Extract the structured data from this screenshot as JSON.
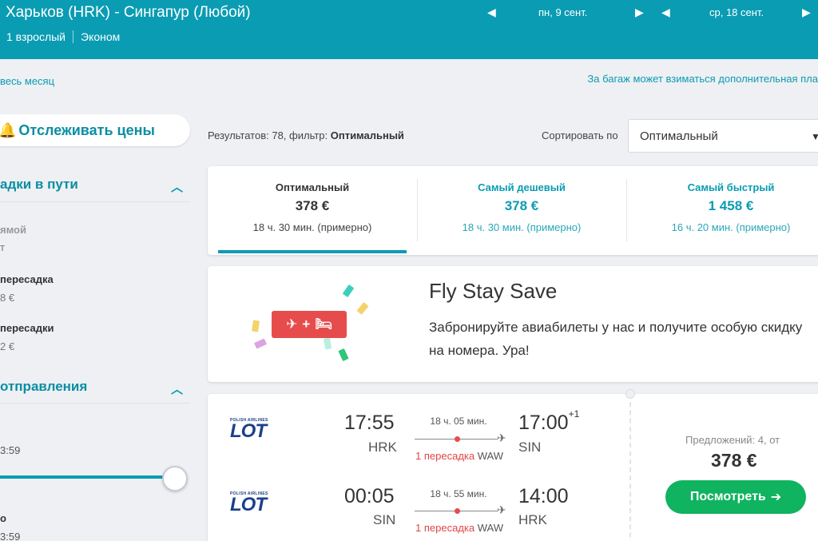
{
  "header": {
    "route": "Харьков (HRK) - Сингапур (Любой)",
    "passengers": "1 взрослый",
    "cabin": "Эконом",
    "depart_date": "пн, 9 сент.",
    "return_date": "ср, 18 сент."
  },
  "links": {
    "whole_month": "весь месяц",
    "baggage": "За багаж может взиматься дополнительная пла"
  },
  "sidebar": {
    "track_label": "Отслеживать цены",
    "stops_title": "адки в пути",
    "stops": [
      {
        "label": "ямой",
        "price": "т"
      },
      {
        "label": "пересадка",
        "price": "8 €"
      },
      {
        "label": "пересадки",
        "price": "2 €"
      }
    ],
    "departure_title": "отправления",
    "time1": "3:59",
    "time2": "3:59",
    "knob_label": "о",
    "slider_level_percent": 100
  },
  "results": {
    "count_text": "Результатов: 78, фильтр: ",
    "filter": "Оптимальный",
    "sort_label": "Сортировать по",
    "sort_value": "Оптимальный"
  },
  "tabs": [
    {
      "title": "Оптимальный",
      "price": "378 €",
      "duration": "18 ч. 30 мин. (примерно)"
    },
    {
      "title": "Самый дешевый",
      "price": "378 €",
      "duration": "18 ч. 30 мин. (примерно)"
    },
    {
      "title": "Самый быстрый",
      "price": "1 458 €",
      "duration": "16 ч. 20 мин. (примерно)"
    }
  ],
  "promo": {
    "title": "Fly Stay Save",
    "text": "Забронируйте авиабилеты у нас и получите особую скидку на номера. Ура!",
    "badge_plus": "+"
  },
  "flight": {
    "airline_small": "POLISH AIRLINES",
    "airline_logo": "LOT",
    "legs": [
      {
        "dep_time": "17:55",
        "dep_code": "HRK",
        "duration": "18 ч. 05 мин.",
        "arr_time": "17:00",
        "arr_sup": "+1",
        "arr_code": "SIN",
        "stops": "1 пересадка",
        "via": "WAW"
      },
      {
        "dep_time": "00:05",
        "dep_code": "SIN",
        "duration": "18 ч. 55 мин.",
        "arr_time": "14:00",
        "arr_sup": "",
        "arr_code": "HRK",
        "stops": "1 пересадка",
        "via": "WAW"
      }
    ],
    "offers": "Предложений: 4, от",
    "price": "378 €",
    "view_label": "Посмотреть"
  },
  "colors": {
    "brand": "#0a9cb3",
    "accent_red": "#e74c4c",
    "cta_green": "#10b35f"
  }
}
